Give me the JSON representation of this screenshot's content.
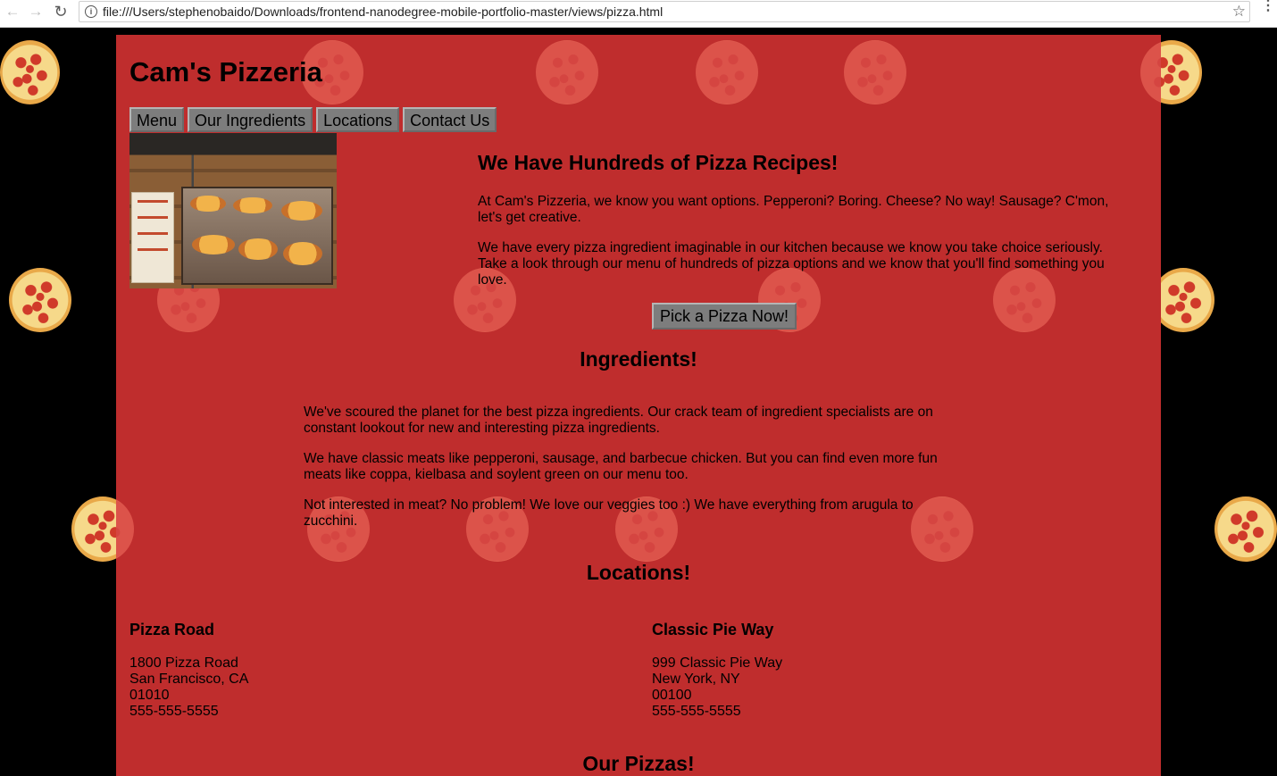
{
  "browser": {
    "url": "file:///Users/stephenobaido/Downloads/frontend-nanodegree-mobile-portfolio-master/views/pizza.html",
    "back_glyph": "←",
    "forward_glyph": "→",
    "reload_glyph": "↻",
    "star_glyph": "☆",
    "info_glyph": "i",
    "menu_glyph": "⋮"
  },
  "site": {
    "title": "Cam's Pizzeria",
    "nav": [
      "Menu",
      "Our Ingredients",
      "Locations",
      "Contact Us"
    ]
  },
  "hero": {
    "heading": "We Have Hundreds of Pizza Recipes!",
    "paragraphs": [
      "At Cam's Pizzeria, we know you want options. Pepperoni? Boring. Cheese? No way! Sausage? C'mon, let's get creative.",
      "We have every pizza ingredient imaginable in our kitchen because we know you take choice seriously. Take a look through our menu of hundreds of pizza options and we know that you'll find something you love."
    ],
    "cta": "Pick a Pizza Now!"
  },
  "ingredients": {
    "heading": "Ingredients!",
    "paragraphs": [
      "We've scoured the planet for the best pizza ingredients. Our crack team of ingredient specialists are on constant lookout for new and interesting pizza ingredients.",
      "We have classic meats like pepperoni, sausage, and barbecue chicken. But you can find even more fun meats like coppa, kielbasa and soylent green on our menu too.",
      "Not interested in meat? No problem! We love our veggies too :) We have everything from arugula to zucchini."
    ]
  },
  "locations": {
    "heading": "Locations!",
    "items": [
      {
        "name": "Pizza Road",
        "lines": [
          "1800 Pizza Road",
          "San Francisco, CA",
          "01010",
          "555-555-5555"
        ]
      },
      {
        "name": "Classic Pie Way",
        "lines": [
          "999 Classic Pie Way",
          "New York, NY",
          "00100",
          "555-555-5555"
        ]
      }
    ]
  },
  "pizzas_section": {
    "heading": "Our Pizzas!"
  },
  "colors": {
    "page_bg": "#000000",
    "container_bg": "#bf2d2d",
    "button_bg": "#7d7d7d"
  }
}
